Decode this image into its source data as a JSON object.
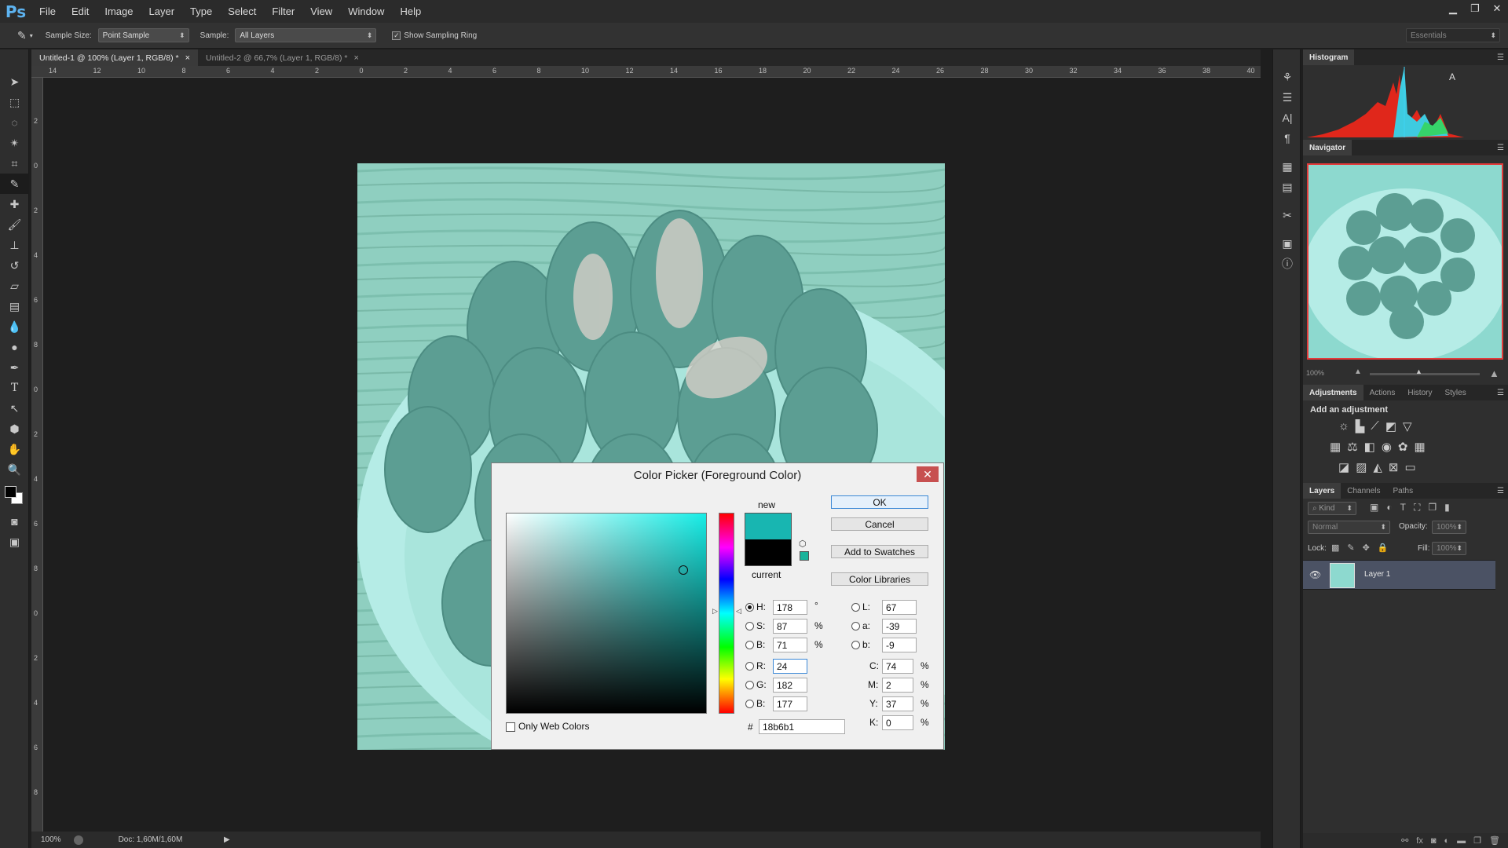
{
  "app": {
    "logo": "Ps"
  },
  "menu": [
    "File",
    "Edit",
    "Image",
    "Layer",
    "Type",
    "Select",
    "Filter",
    "View",
    "Window",
    "Help"
  ],
  "options": {
    "sample_size_label": "Sample Size:",
    "sample_size_value": "Point Sample",
    "sample_label": "Sample:",
    "sample_value": "All Layers",
    "show_sampling_ring": "Show Sampling Ring",
    "workspace": "Essentials"
  },
  "tabs": [
    {
      "label": "Untitled-1 @ 100% (Layer 1, RGB/8) *",
      "active": true
    },
    {
      "label": "Untitled-2 @ 66,7% (Layer 1, RGB/8) *",
      "active": false
    }
  ],
  "rulers": {
    "h_ticks": [
      "14",
      "12",
      "10",
      "8",
      "6",
      "4",
      "2",
      "0",
      "2",
      "4",
      "6",
      "8",
      "10",
      "12",
      "14",
      "16",
      "18",
      "20",
      "22",
      "24",
      "26",
      "28",
      "30",
      "32",
      "34",
      "36",
      "38",
      "40"
    ],
    "v_ticks": [
      "2",
      "0",
      "2",
      "4",
      "6",
      "8",
      "0",
      "2",
      "4",
      "6",
      "8",
      "0",
      "2",
      "4",
      "6",
      "8"
    ]
  },
  "status": {
    "zoom": "100%",
    "doc": "Doc: 1,60M/1,60M"
  },
  "panels": {
    "histogram": {
      "title": "Histogram"
    },
    "navigator": {
      "title": "Navigator",
      "zoom": "100%"
    },
    "adjustments": {
      "tabs": [
        "Adjustments",
        "Actions",
        "History",
        "Styles"
      ],
      "heading": "Add an adjustment"
    },
    "layers": {
      "tabs": [
        "Layers",
        "Channels",
        "Paths"
      ],
      "kind": "Kind",
      "blend_mode": "Normal",
      "opacity_label": "Opacity:",
      "opacity_value": "100%",
      "lock_label": "Lock:",
      "fill_label": "Fill:",
      "fill_value": "100%",
      "layer_name": "Layer 1"
    }
  },
  "dialog": {
    "title": "Color Picker (Foreground Color)",
    "close": "✕",
    "ok": "OK",
    "cancel": "Cancel",
    "add_swatches": "Add to Swatches",
    "color_libraries": "Color Libraries",
    "new_label": "new",
    "current_label": "current",
    "new_color": "#18b6b1",
    "current_color": "#000000",
    "only_web": "Only Web Colors",
    "hsb": {
      "H": "178",
      "S": "87",
      "B": "71"
    },
    "rgb": {
      "R": "24",
      "G": "182",
      "B": "177"
    },
    "lab": {
      "L": "67",
      "a": "-39",
      "b": "-9"
    },
    "cmyk": {
      "C": "74",
      "M": "2",
      "Y": "37",
      "K": "0"
    },
    "hex_label": "#",
    "hex": "18b6b1",
    "units": {
      "deg": "°",
      "pct": "%"
    }
  },
  "colors": {
    "accent_tint": "#8dd9cf",
    "close_red": "#c75050"
  }
}
